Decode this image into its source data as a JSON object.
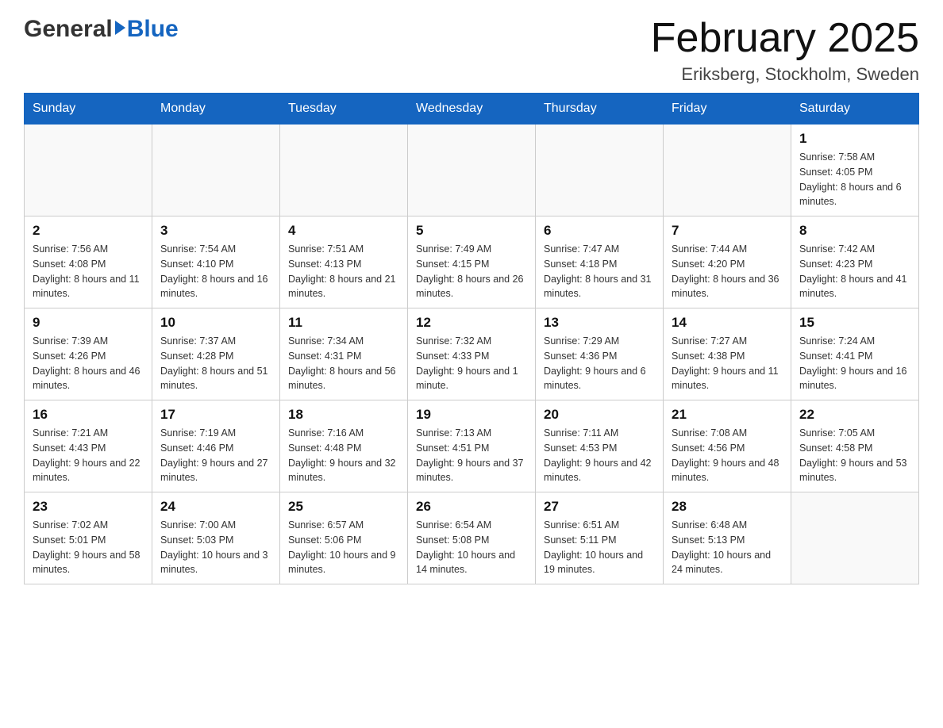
{
  "header": {
    "logo_general": "General",
    "logo_blue": "Blue",
    "month_title": "February 2025",
    "location": "Eriksberg, Stockholm, Sweden"
  },
  "days_of_week": [
    "Sunday",
    "Monday",
    "Tuesday",
    "Wednesday",
    "Thursday",
    "Friday",
    "Saturday"
  ],
  "weeks": [
    [
      {
        "day": "",
        "sunrise": "",
        "sunset": "",
        "daylight": ""
      },
      {
        "day": "",
        "sunrise": "",
        "sunset": "",
        "daylight": ""
      },
      {
        "day": "",
        "sunrise": "",
        "sunset": "",
        "daylight": ""
      },
      {
        "day": "",
        "sunrise": "",
        "sunset": "",
        "daylight": ""
      },
      {
        "day": "",
        "sunrise": "",
        "sunset": "",
        "daylight": ""
      },
      {
        "day": "",
        "sunrise": "",
        "sunset": "",
        "daylight": ""
      },
      {
        "day": "1",
        "sunrise": "Sunrise: 7:58 AM",
        "sunset": "Sunset: 4:05 PM",
        "daylight": "Daylight: 8 hours and 6 minutes."
      }
    ],
    [
      {
        "day": "2",
        "sunrise": "Sunrise: 7:56 AM",
        "sunset": "Sunset: 4:08 PM",
        "daylight": "Daylight: 8 hours and 11 minutes."
      },
      {
        "day": "3",
        "sunrise": "Sunrise: 7:54 AM",
        "sunset": "Sunset: 4:10 PM",
        "daylight": "Daylight: 8 hours and 16 minutes."
      },
      {
        "day": "4",
        "sunrise": "Sunrise: 7:51 AM",
        "sunset": "Sunset: 4:13 PM",
        "daylight": "Daylight: 8 hours and 21 minutes."
      },
      {
        "day": "5",
        "sunrise": "Sunrise: 7:49 AM",
        "sunset": "Sunset: 4:15 PM",
        "daylight": "Daylight: 8 hours and 26 minutes."
      },
      {
        "day": "6",
        "sunrise": "Sunrise: 7:47 AM",
        "sunset": "Sunset: 4:18 PM",
        "daylight": "Daylight: 8 hours and 31 minutes."
      },
      {
        "day": "7",
        "sunrise": "Sunrise: 7:44 AM",
        "sunset": "Sunset: 4:20 PM",
        "daylight": "Daylight: 8 hours and 36 minutes."
      },
      {
        "day": "8",
        "sunrise": "Sunrise: 7:42 AM",
        "sunset": "Sunset: 4:23 PM",
        "daylight": "Daylight: 8 hours and 41 minutes."
      }
    ],
    [
      {
        "day": "9",
        "sunrise": "Sunrise: 7:39 AM",
        "sunset": "Sunset: 4:26 PM",
        "daylight": "Daylight: 8 hours and 46 minutes."
      },
      {
        "day": "10",
        "sunrise": "Sunrise: 7:37 AM",
        "sunset": "Sunset: 4:28 PM",
        "daylight": "Daylight: 8 hours and 51 minutes."
      },
      {
        "day": "11",
        "sunrise": "Sunrise: 7:34 AM",
        "sunset": "Sunset: 4:31 PM",
        "daylight": "Daylight: 8 hours and 56 minutes."
      },
      {
        "day": "12",
        "sunrise": "Sunrise: 7:32 AM",
        "sunset": "Sunset: 4:33 PM",
        "daylight": "Daylight: 9 hours and 1 minute."
      },
      {
        "day": "13",
        "sunrise": "Sunrise: 7:29 AM",
        "sunset": "Sunset: 4:36 PM",
        "daylight": "Daylight: 9 hours and 6 minutes."
      },
      {
        "day": "14",
        "sunrise": "Sunrise: 7:27 AM",
        "sunset": "Sunset: 4:38 PM",
        "daylight": "Daylight: 9 hours and 11 minutes."
      },
      {
        "day": "15",
        "sunrise": "Sunrise: 7:24 AM",
        "sunset": "Sunset: 4:41 PM",
        "daylight": "Daylight: 9 hours and 16 minutes."
      }
    ],
    [
      {
        "day": "16",
        "sunrise": "Sunrise: 7:21 AM",
        "sunset": "Sunset: 4:43 PM",
        "daylight": "Daylight: 9 hours and 22 minutes."
      },
      {
        "day": "17",
        "sunrise": "Sunrise: 7:19 AM",
        "sunset": "Sunset: 4:46 PM",
        "daylight": "Daylight: 9 hours and 27 minutes."
      },
      {
        "day": "18",
        "sunrise": "Sunrise: 7:16 AM",
        "sunset": "Sunset: 4:48 PM",
        "daylight": "Daylight: 9 hours and 32 minutes."
      },
      {
        "day": "19",
        "sunrise": "Sunrise: 7:13 AM",
        "sunset": "Sunset: 4:51 PM",
        "daylight": "Daylight: 9 hours and 37 minutes."
      },
      {
        "day": "20",
        "sunrise": "Sunrise: 7:11 AM",
        "sunset": "Sunset: 4:53 PM",
        "daylight": "Daylight: 9 hours and 42 minutes."
      },
      {
        "day": "21",
        "sunrise": "Sunrise: 7:08 AM",
        "sunset": "Sunset: 4:56 PM",
        "daylight": "Daylight: 9 hours and 48 minutes."
      },
      {
        "day": "22",
        "sunrise": "Sunrise: 7:05 AM",
        "sunset": "Sunset: 4:58 PM",
        "daylight": "Daylight: 9 hours and 53 minutes."
      }
    ],
    [
      {
        "day": "23",
        "sunrise": "Sunrise: 7:02 AM",
        "sunset": "Sunset: 5:01 PM",
        "daylight": "Daylight: 9 hours and 58 minutes."
      },
      {
        "day": "24",
        "sunrise": "Sunrise: 7:00 AM",
        "sunset": "Sunset: 5:03 PM",
        "daylight": "Daylight: 10 hours and 3 minutes."
      },
      {
        "day": "25",
        "sunrise": "Sunrise: 6:57 AM",
        "sunset": "Sunset: 5:06 PM",
        "daylight": "Daylight: 10 hours and 9 minutes."
      },
      {
        "day": "26",
        "sunrise": "Sunrise: 6:54 AM",
        "sunset": "Sunset: 5:08 PM",
        "daylight": "Daylight: 10 hours and 14 minutes."
      },
      {
        "day": "27",
        "sunrise": "Sunrise: 6:51 AM",
        "sunset": "Sunset: 5:11 PM",
        "daylight": "Daylight: 10 hours and 19 minutes."
      },
      {
        "day": "28",
        "sunrise": "Sunrise: 6:48 AM",
        "sunset": "Sunset: 5:13 PM",
        "daylight": "Daylight: 10 hours and 24 minutes."
      },
      {
        "day": "",
        "sunrise": "",
        "sunset": "",
        "daylight": ""
      }
    ]
  ]
}
